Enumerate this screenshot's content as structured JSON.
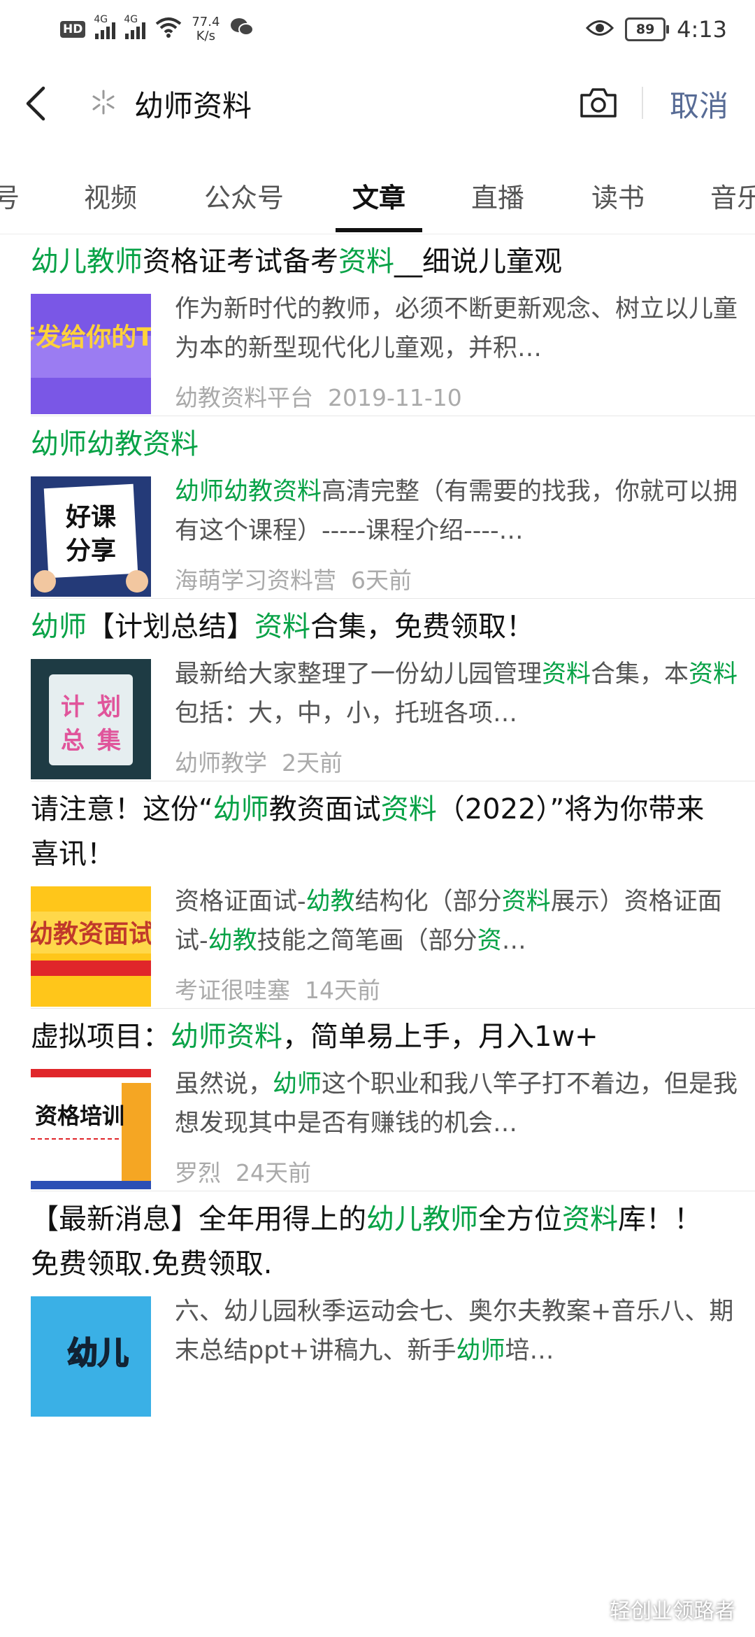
{
  "status_bar": {
    "hd": "HD",
    "sim1": "4G",
    "sim2": "4G",
    "speed_value": "77.4",
    "speed_unit": "K/s",
    "battery": "89",
    "time": "4:13"
  },
  "search": {
    "query": "幼师资料",
    "cancel_label": "取消"
  },
  "tabs": [
    "号",
    "视频",
    "公众号",
    "文章",
    "直播",
    "读书",
    "音乐"
  ],
  "active_tab": "文章",
  "results": [
    {
      "title": [
        [
          "幼儿教师",
          true
        ],
        [
          "资格证考试备考",
          false
        ],
        [
          "资料",
          true
        ],
        [
          "__细说儿童观",
          false
        ]
      ],
      "snippet": [
        [
          "作为新时代的教师，必须不断更新观念、树立以儿童为本的新型现代化儿童观，并积…",
          false
        ]
      ],
      "source": "幼教资料平台",
      "time": "2019-11-10",
      "thumb_text": "传发给你的TA"
    },
    {
      "title": [
        [
          "幼师幼教资料",
          true
        ]
      ],
      "snippet": [
        [
          "幼师幼教资料",
          true
        ],
        [
          "高清完整（有需要的找我，你就可以拥有这个课程）-----课程介绍----…",
          false
        ]
      ],
      "source": "海萌学习资料营",
      "time": "6天前",
      "thumb_text": "好课分享"
    },
    {
      "title": [
        [
          "幼师",
          true
        ],
        [
          "【计划总结】",
          false
        ],
        [
          "资料",
          true
        ],
        [
          "合集，免费领取！",
          false
        ]
      ],
      "snippet": [
        [
          "最新给大家整理了一份幼儿园管理",
          false
        ],
        [
          "资料",
          true
        ],
        [
          "合集，本",
          false
        ],
        [
          "资料",
          true
        ],
        [
          "包括：大，中，小，托班各项…",
          false
        ]
      ],
      "source": "幼师教学",
      "time": "2天前",
      "thumb_text": "计划总集"
    },
    {
      "title": [
        [
          "请注意！这份“",
          false
        ],
        [
          "幼师",
          true
        ],
        [
          "教资面试",
          false
        ],
        [
          "资料",
          true
        ],
        [
          "（2022）”将为你带来喜讯！",
          false
        ]
      ],
      "snippet": [
        [
          "资格证面试-",
          false
        ],
        [
          "幼教",
          true
        ],
        [
          "结构化（部分",
          false
        ],
        [
          "资料",
          true
        ],
        [
          "展示）资格证面试-",
          false
        ],
        [
          "幼教",
          true
        ],
        [
          "技能之简笔画（部分",
          false
        ],
        [
          "资",
          true
        ],
        [
          "…",
          false
        ]
      ],
      "source": "考证很哇塞",
      "time": "14天前",
      "thumb_text": "幼教资面试"
    },
    {
      "title": [
        [
          "虚拟项目：",
          false
        ],
        [
          "幼师资料",
          true
        ],
        [
          "，简单易上手，月入1w+",
          false
        ]
      ],
      "snippet": [
        [
          "虽然说，",
          false
        ],
        [
          "幼师",
          true
        ],
        [
          "这个职业和我八竿子打不着边，但是我想发现其中是否有赚钱的机会…",
          false
        ]
      ],
      "source": "罗烈",
      "time": "24天前",
      "thumb_text": "资格培训"
    },
    {
      "title": [
        [
          "【最新消息】全年用得上的",
          false
        ],
        [
          "幼儿教师",
          true
        ],
        [
          "全方位",
          false
        ],
        [
          "资料",
          true
        ],
        [
          "库！！免费领取.免费领取.",
          false
        ]
      ],
      "snippet": [
        [
          "六、幼儿园秋季运动会七、奥尔夫教案+音乐八、期末总结ppt+讲稿九、新手",
          false
        ],
        [
          "幼师",
          true
        ],
        [
          "培…",
          false
        ]
      ],
      "source": "",
      "time": "",
      "thumb_text": "幼儿"
    }
  ],
  "watermark": "轻创业领路者",
  "colors": {
    "highlight": "#07a246",
    "cancel": "#576b95"
  }
}
